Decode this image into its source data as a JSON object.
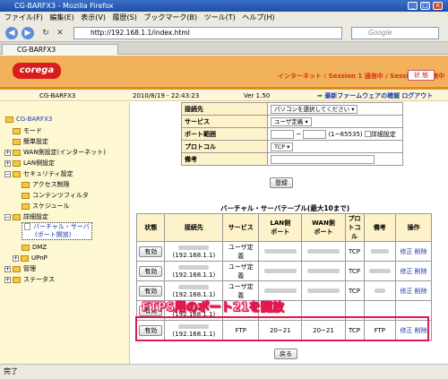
{
  "window": {
    "title": "CG-BARFX3 - Mozilla Firefox",
    "min": "_",
    "max": "□",
    "close": "×"
  },
  "menu": [
    "ファイル(F)",
    "編集(E)",
    "表示(V)",
    "履歴(S)",
    "ブックマーク(B)",
    "ツール(T)",
    "ヘルプ(H)"
  ],
  "nav": {
    "url": "http://192.168.1.1/index.html",
    "search_placeholder": "Google"
  },
  "tab": {
    "label": "CG-BARFX3"
  },
  "header": {
    "logo": "corega",
    "session": "インターネット : Session 1 通信中 / Session 2 通信中",
    "status_btn": "状 態"
  },
  "subbar": {
    "model": "CG-BARFX3",
    "datetime": "2010/8/19 - 22:43:23",
    "version": "Ver 1.50",
    "firmware_link": "最新ファームウェアの確認",
    "logout_link": "ログアウト"
  },
  "sidebar": {
    "root": "CG-BARFX3",
    "items": [
      "モード",
      "簡単設定",
      "WAN側設定(インターネット)",
      "LAN側設定",
      "セキュリティ設定",
      "アクセス制限",
      "コンテンツフィルタ",
      "スケジュール",
      "詳細設定",
      "バーチャル・サーバ",
      "(ポート開放)",
      "DMZ",
      "UPnP",
      "管理",
      "ステータス"
    ]
  },
  "form": {
    "rows": [
      {
        "label": "接続先",
        "value": "パソコンを選択してください"
      },
      {
        "label": "サービス",
        "value": "ユーザ定義"
      },
      {
        "label": "ポート範囲",
        "value": "~",
        "range": "(1~65535)",
        "detail": "詳細設定"
      },
      {
        "label": "プロトコル",
        "value": "TCP"
      },
      {
        "label": "備考",
        "value": ""
      }
    ],
    "register_btn": "登録"
  },
  "table": {
    "caption": "バーチャル・サーバテーブル(最大10まで)",
    "headers": [
      "状態",
      "接続先",
      "サービス",
      "LAN側\nポート",
      "WAN側\nポート",
      "プロ\nトコル",
      "備考",
      "操作"
    ],
    "enable_label": "有効",
    "rows": [
      {
        "host": "(192.168.1.1)",
        "service": "ユーザ定義",
        "proto": "TCP",
        "edit": "修正",
        "del": "削除"
      },
      {
        "host": "(192.168.1.1)",
        "service": "ユーザ定義",
        "proto": "TCP",
        "edit": "修正",
        "del": "削除"
      },
      {
        "host": "(192.168.1.1)",
        "service": "ユーザ定義",
        "proto": "TCP",
        "edit": "修正",
        "del": "削除"
      },
      {
        "host": "(192.168.1.1)",
        "service": "",
        "proto": "",
        "edit": "",
        "del": ""
      },
      {
        "host": "(192.168.1.1)",
        "service": "FTP",
        "lan": "20~21",
        "wan": "20~21",
        "proto": "TCP",
        "note": "FTP",
        "edit": "修正",
        "del": "削除"
      }
    ],
    "back_btn": "戻る"
  },
  "overlay_text": "FTPS用のポート21を開放",
  "statusbar": {
    "text": "完了"
  }
}
